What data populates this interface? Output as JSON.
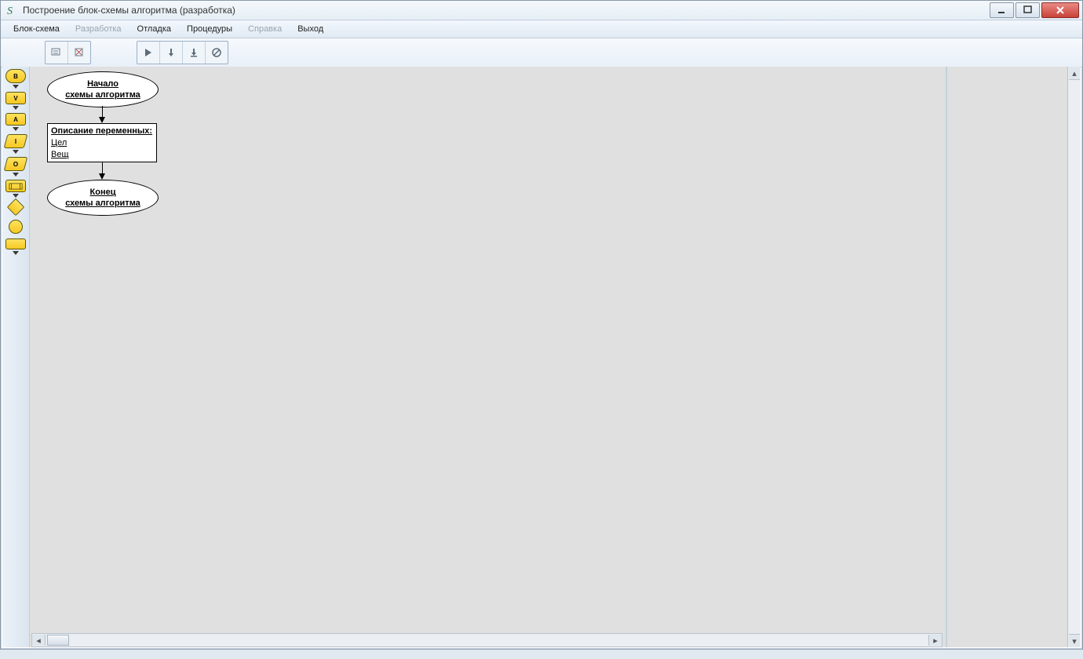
{
  "window": {
    "title": "Построение блок-схемы алгоритма (разработка)"
  },
  "menu": {
    "block_scheme": "Блок-схема",
    "development": "Разработка",
    "debug": "Отладка",
    "procedures": "Процедуры",
    "help": "Справка",
    "exit": "Выход"
  },
  "flow": {
    "start_l1": "Начало",
    "start_l2": "схемы алгоритма",
    "vars_title": "Описание переменных:",
    "vars_int": "Цел",
    "vars_real": "Вещ",
    "end_l1": "Конец",
    "end_l2": "схемы алгоритма"
  }
}
